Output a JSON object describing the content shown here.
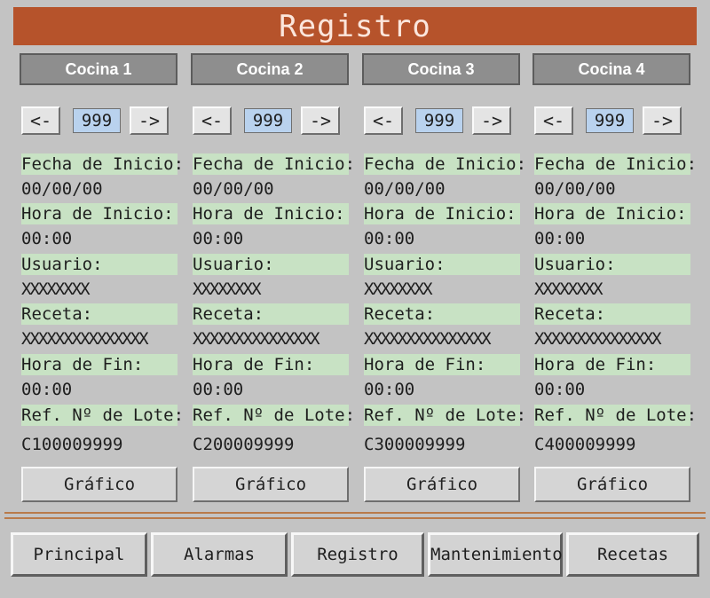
{
  "title": "Registro",
  "kitchens": [
    {
      "name": "Cocina 1",
      "prev_label": "<-",
      "next_label": "->",
      "counter": "999",
      "start_date_label": "Fecha de Inicio:",
      "start_date": "00/00/00",
      "start_time_label": "Hora de Inicio:",
      "start_time": "00:00",
      "user_label": "Usuario:",
      "user": "XXXXXXXX",
      "recipe_label": "Receta:",
      "recipe": "XXXXXXXXXXXXXXX",
      "end_time_label": "Hora de Fin:",
      "end_time": "00:00",
      "lot_label": "Ref. Nº de Lote:",
      "lot": "C100009999",
      "graph_label": "Gráfico"
    },
    {
      "name": "Cocina 2",
      "prev_label": "<-",
      "next_label": "->",
      "counter": "999",
      "start_date_label": "Fecha de Inicio:",
      "start_date": "00/00/00",
      "start_time_label": "Hora de Inicio:",
      "start_time": "00:00",
      "user_label": "Usuario:",
      "user": "XXXXXXXX",
      "recipe_label": "Receta:",
      "recipe": "XXXXXXXXXXXXXXX",
      "end_time_label": "Hora de Fin:",
      "end_time": "00:00",
      "lot_label": "Ref. Nº de Lote:",
      "lot": "C200009999",
      "graph_label": "Gráfico"
    },
    {
      "name": "Cocina 3",
      "prev_label": "<-",
      "next_label": "->",
      "counter": "999",
      "start_date_label": "Fecha de Inicio:",
      "start_date": "00/00/00",
      "start_time_label": "Hora de Inicio:",
      "start_time": "00:00",
      "user_label": "Usuario:",
      "user": "XXXXXXXX",
      "recipe_label": "Receta:",
      "recipe": "XXXXXXXXXXXXXXX",
      "end_time_label": "Hora de Fin:",
      "end_time": "00:00",
      "lot_label": "Ref. Nº de Lote:",
      "lot": "C300009999",
      "graph_label": "Gráfico"
    },
    {
      "name": "Cocina 4",
      "prev_label": "<-",
      "next_label": "->",
      "counter": "999",
      "start_date_label": "Fecha de Inicio:",
      "start_date": "00/00/00",
      "start_time_label": "Hora de Inicio:",
      "start_time": "00:00",
      "user_label": "Usuario:",
      "user": "XXXXXXXX",
      "recipe_label": "Receta:",
      "recipe": "XXXXXXXXXXXXXXX",
      "end_time_label": "Hora de Fin:",
      "end_time": "00:00",
      "lot_label": "Ref. Nº de Lote:",
      "lot": "C400009999",
      "graph_label": "Gráfico"
    }
  ],
  "nav": {
    "principal": "Principal",
    "alarmas": "Alarmas",
    "registro": "Registro",
    "mantenimiento": "Mantenimiento",
    "recetas": "Recetas"
  },
  "colors": {
    "title_bar": "#b6532b",
    "label_bg": "#c8e2c4",
    "counter_bg": "#b9d2ee",
    "background": "#c3c3c3"
  }
}
